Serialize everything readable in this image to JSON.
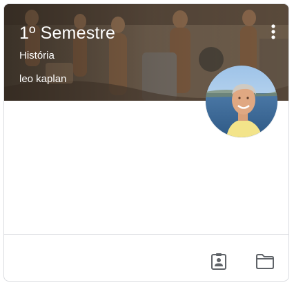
{
  "course": {
    "title": "1º Semestre",
    "subject": "História",
    "teacher": "leo kaplan"
  },
  "colors": {
    "icon": "#5f6368",
    "border": "#dadce0",
    "header_text": "#ffffff"
  },
  "icons": {
    "menu": "more-vert-icon",
    "portfolio": "assignment-ind-icon",
    "folder": "folder-icon"
  }
}
